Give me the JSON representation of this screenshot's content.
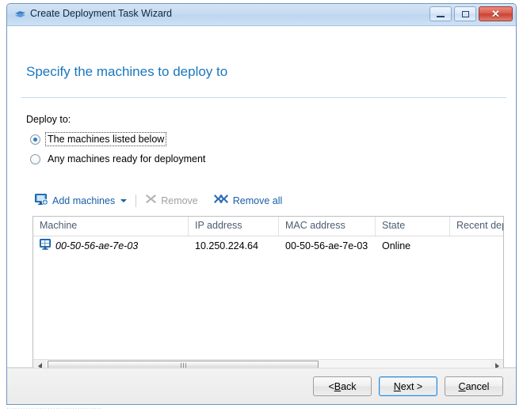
{
  "window": {
    "title": "Create Deployment Task Wizard",
    "icon": "wizard-wand-icon",
    "controls": {
      "minimize": "minimize-button",
      "maximize": "maximize-button",
      "close": "close-button"
    }
  },
  "page": {
    "title": "Specify the machines to deploy to",
    "title_color": "#1977bd"
  },
  "deploy": {
    "label": "Deploy to:",
    "options": [
      {
        "label": "The machines listed below",
        "selected": true,
        "focused": true
      },
      {
        "label": "Any machines ready for deployment",
        "selected": false,
        "focused": false
      }
    ]
  },
  "toolbar": {
    "add_machines": {
      "label": "Add machines",
      "icon": "monitor-add-icon",
      "enabled": true,
      "has_dropdown": true
    },
    "remove": {
      "label": "Remove",
      "icon": "x-mark-icon",
      "enabled": false
    },
    "remove_all": {
      "label": "Remove all",
      "icon": "double-x-mark-icon",
      "enabled": true
    }
  },
  "table": {
    "columns": [
      {
        "label": "Machine",
        "width": 196
      },
      {
        "label": "IP address",
        "width": 114
      },
      {
        "label": "MAC address",
        "width": 122
      },
      {
        "label": "State",
        "width": 94
      },
      {
        "label": "Recent dep",
        "width": 67
      }
    ],
    "rows": [
      {
        "icon": "monitor-icon",
        "machine": "00-50-56-ae-7e-03",
        "ip_address": "10.250.224.64",
        "mac_address": "00-50-56-ae-7e-03",
        "state": "Online",
        "recent_deployment": ""
      }
    ],
    "hscroll": {
      "thumb_percent": 61
    }
  },
  "footer": {
    "buttons": [
      {
        "prefix": "< ",
        "accel": "B",
        "suffix": "ack",
        "default": false,
        "name": "back-button"
      },
      {
        "prefix": "",
        "accel": "N",
        "suffix": "ext >",
        "default": true,
        "name": "next-button"
      },
      {
        "prefix": "",
        "accel": "C",
        "suffix": "ancel",
        "default": false,
        "name": "cancel-button"
      }
    ]
  },
  "background_bleed": "..................................."
}
